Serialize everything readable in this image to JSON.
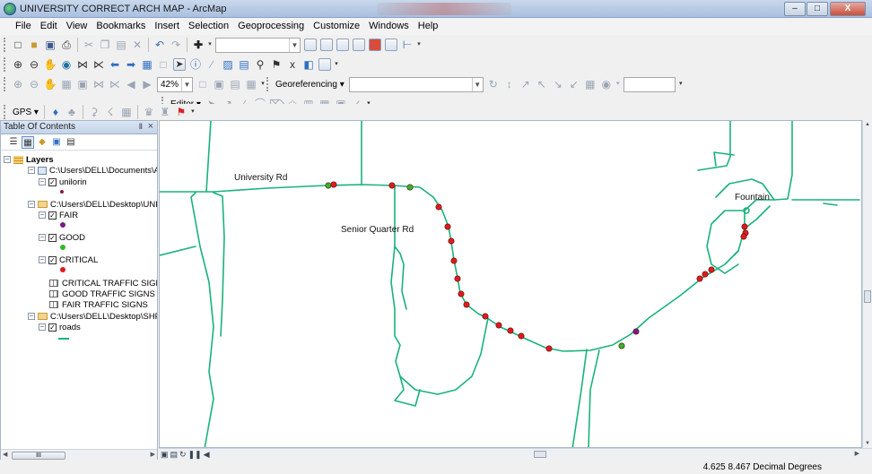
{
  "window": {
    "title": "UNIVERSITY CORRECT ARCH MAP - ArcMap",
    "minimize": "–",
    "maximize": "□",
    "close": "X"
  },
  "menu": [
    "File",
    "Edit",
    "View",
    "Bookmarks",
    "Insert",
    "Selection",
    "Geoprocessing",
    "Customize",
    "Windows",
    "Help"
  ],
  "toolbars": {
    "zoom_level": "42%",
    "georeferencing_label": "Georeferencing",
    "editor_label": "Editor",
    "gps_label": "GPS"
  },
  "toc": {
    "title": "Table Of Contents",
    "pin": "Ⅱ",
    "close": "×",
    "root": "Layers",
    "group1_path": "C:\\Users\\DELL\\Documents\\Arc",
    "layer_unilorin": "unilorin",
    "group2_path": "C:\\Users\\DELL\\Desktop\\UNIVEI",
    "layer_fair": "FAIR",
    "layer_good": "GOOD",
    "layer_critical": "CRITICAL",
    "table_critical": "CRITICAL TRAFFIC SIGNS",
    "table_good": "GOOD TRAFFIC SIGNS",
    "table_fair": "FAIR TRAFFIC SIGNS",
    "group3_path": "C:\\Users\\DELL\\Desktop\\SHP",
    "layer_roads": "roads",
    "scroll_label": "III"
  },
  "map": {
    "labels": {
      "university_rd": "University Rd",
      "senior_quarter_rd": "Senior Quarter Rd",
      "fountain": "Fountain"
    },
    "symbol_colors": {
      "critical": "#e01b1b",
      "good": "#35b52f",
      "fair": "#7b1a86",
      "unilorin": "#8b1a3c",
      "roads": "#1ab27a"
    }
  },
  "status": {
    "coordinates": "4.625  8.467 Decimal Degrees"
  }
}
